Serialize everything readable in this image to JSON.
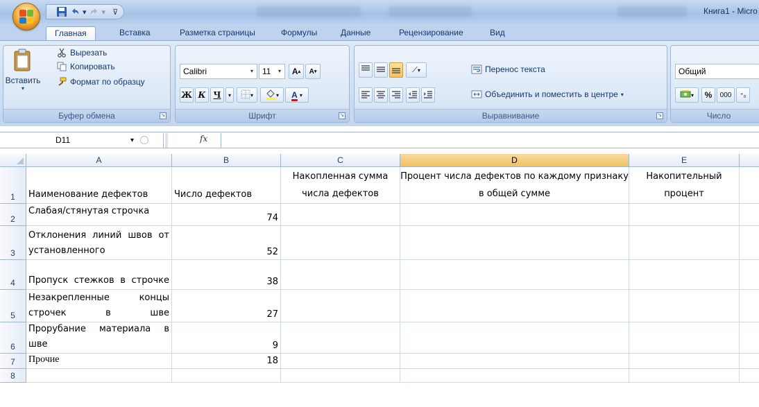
{
  "window": {
    "title": "Книга1 - Micro"
  },
  "tabs": {
    "home": "Главная",
    "insert": "Вставка",
    "page_layout": "Разметка страницы",
    "formulas": "Формулы",
    "data": "Данные",
    "review": "Рецензирование",
    "view": "Вид"
  },
  "clipboard": {
    "title": "Буфер обмена",
    "paste": "Вставить",
    "cut": "Вырезать",
    "copy": "Копировать",
    "format_painter": "Формат по образцу"
  },
  "font": {
    "title": "Шрифт",
    "name": "Calibri",
    "size": "11",
    "bold": "Ж",
    "italic": "К",
    "underline": "Ч",
    "grow": "A",
    "shrink": "A",
    "font_color": "A",
    "highlight_color": "#ffff00",
    "text_color": "#ff0000"
  },
  "alignment": {
    "title": "Выравнивание",
    "wrap_text": "Перенос текста",
    "merge_center": "Объединить и поместить в центре"
  },
  "number": {
    "title": "Число",
    "format": "Общий",
    "percent": "%",
    "thousands": "000"
  },
  "formula_bar": {
    "cell_ref": "D11",
    "fx": "fx",
    "value": ""
  },
  "sheet": {
    "columns": [
      "A",
      "B",
      "C",
      "D",
      "E"
    ],
    "rows": [
      {
        "num": "1",
        "a": "Наименование дефектов",
        "b": "Число дефектов",
        "c": "Накопленная сумма числа дефектов",
        "d": "Процент числа дефектов по каждому признаку в общей сумме",
        "e": "Накопительный процент"
      },
      {
        "num": "2",
        "a": "Слабая/стянутая строчка",
        "b": "74",
        "c": "",
        "d": "",
        "e": ""
      },
      {
        "num": "3",
        "a": "Отклонения линий швов от установленного",
        "b": "52",
        "c": "",
        "d": "",
        "e": ""
      },
      {
        "num": "4",
        "a": "Пропуск стежков в строчке",
        "b": "38",
        "c": "",
        "d": "",
        "e": ""
      },
      {
        "num": "5",
        "a": "Незакрепленные концы строчек в шве",
        "b": "27",
        "c": "",
        "d": "",
        "e": ""
      },
      {
        "num": "6",
        "a": "Прорубание материала в шве",
        "b": "9",
        "c": "",
        "d": "",
        "e": ""
      },
      {
        "num": "7",
        "a": "Прочие",
        "b": "18",
        "c": "",
        "d": "",
        "e": ""
      },
      {
        "num": "8",
        "a": "",
        "b": "",
        "c": "",
        "d": "",
        "e": ""
      }
    ]
  }
}
